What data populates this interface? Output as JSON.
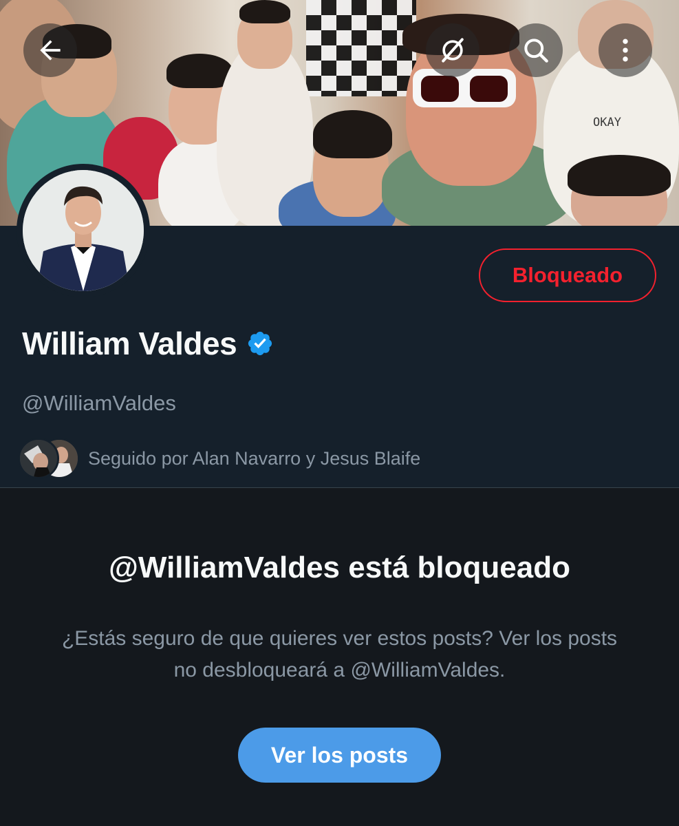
{
  "header": {
    "back_icon": "arrow-left-icon",
    "grok_icon": "grok-slash-icon",
    "search_icon": "search-icon",
    "more_icon": "more-vertical-icon"
  },
  "profile": {
    "display_name": "William Valdes",
    "verified": true,
    "handle": "@WilliamValdes",
    "followed_by_text": "Seguido por Alan Navarro y Jesus Blaife",
    "block_button_label": "Bloqueado"
  },
  "blocked_notice": {
    "title": "@WilliamValdes está bloqueado",
    "description": "¿Estás seguro de que quieres ver estos posts? Ver los posts no desbloqueará a @WilliamValdes.",
    "button_label": "Ver los posts"
  },
  "banner": {
    "shirt_text": "OKAY"
  },
  "colors": {
    "background": "#15202b",
    "lower_background": "#14181d",
    "blocked_red": "#f4212e",
    "primary_blue": "#4c9be8",
    "verified_blue": "#1d9bf0",
    "secondary_text": "#8b98a5"
  }
}
